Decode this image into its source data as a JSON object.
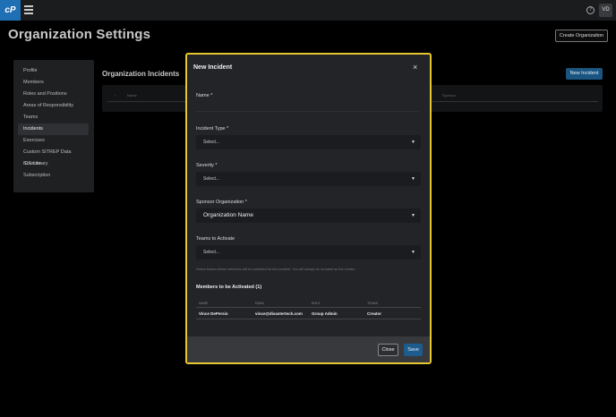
{
  "topbar": {
    "logo_text": "cP",
    "avatar_initials": "VD",
    "help_glyph": "?"
  },
  "page": {
    "title": "Organization Settings",
    "create_org_label": "Create Organization"
  },
  "sidebar": {
    "items": [
      {
        "label": "Profile"
      },
      {
        "label": "Members"
      },
      {
        "label": "Roles and Positions"
      },
      {
        "label": "Areas of Responsibility"
      },
      {
        "label": "Teams"
      },
      {
        "label": "Incidents"
      },
      {
        "label": "Exercises"
      },
      {
        "label": "Custom SITREP Data Sources"
      },
      {
        "label": "ICS Library"
      },
      {
        "label": "Subscription"
      }
    ],
    "active": "Incidents"
  },
  "incidents": {
    "title": "Organization Incidents",
    "new_incident_label": "New Incident",
    "columns": [
      "Name",
      "Sponsor"
    ]
  },
  "modal": {
    "title": "New Incident",
    "close_glyph": "×",
    "name_label": "Name *",
    "type_label": "Incident Type *",
    "type_value": "Select...",
    "severity_label": "Severity *",
    "severity_value": "Select...",
    "sponsor_label": "Sponsor Organization *",
    "sponsor_value": "Organization Name",
    "teams_label": "Teams to Activate",
    "teams_value": "Select...",
    "hint": "Select teams whose members will be activated for this incident. You will always be included as the creator.",
    "members_title": "Members to be Activated (1)",
    "table_headers": [
      "NAME",
      "EMAIL",
      "ROLE",
      "TEAMS"
    ],
    "rows": [
      {
        "name": "Vince DePersio",
        "email": "vince@disastertech.com",
        "role": "Group Admin",
        "teams": "Creator"
      }
    ],
    "close_label": "Close",
    "save_label": "Save"
  },
  "colors": {
    "accent": "#1d5c8d",
    "modal_border": "#e6c630"
  }
}
